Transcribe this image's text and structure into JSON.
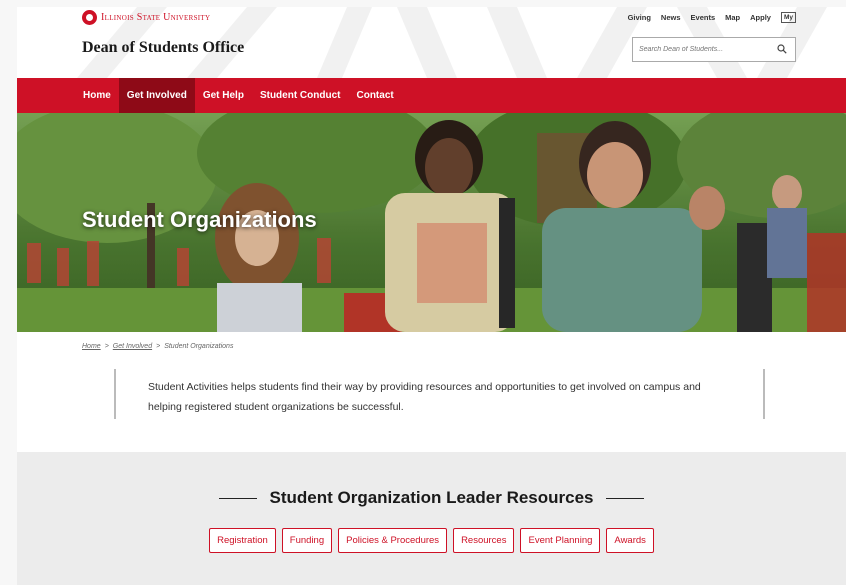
{
  "colors": {
    "brand_red": "#ce1126",
    "nav_active": "#8e0a17"
  },
  "header": {
    "university": "Illinois State University",
    "site_title": "Dean of Students Office",
    "utility_links": [
      "Giving",
      "News",
      "Events",
      "Map",
      "Apply"
    ],
    "my_badge": "My",
    "search_placeholder": "Search Dean of Students..."
  },
  "nav": {
    "items": [
      {
        "label": "Home",
        "active": false
      },
      {
        "label": "Get Involved",
        "active": true
      },
      {
        "label": "Get Help",
        "active": false
      },
      {
        "label": "Student Conduct",
        "active": false
      },
      {
        "label": "Contact",
        "active": false
      }
    ]
  },
  "hero": {
    "title": "Student Organizations"
  },
  "breadcrumb": {
    "home": "Home",
    "sep": ">",
    "parent": "Get Involved",
    "current": "Student Organizations"
  },
  "intro": {
    "text": "Student Activities helps students find their way by providing resources and opportunities to get involved on campus and helping registered student organizations be successful."
  },
  "resources": {
    "title": "Student Organization Leader Resources",
    "buttons": [
      "Registration",
      "Funding",
      "Policies & Procedures",
      "Resources",
      "Event Planning",
      "Awards"
    ]
  }
}
